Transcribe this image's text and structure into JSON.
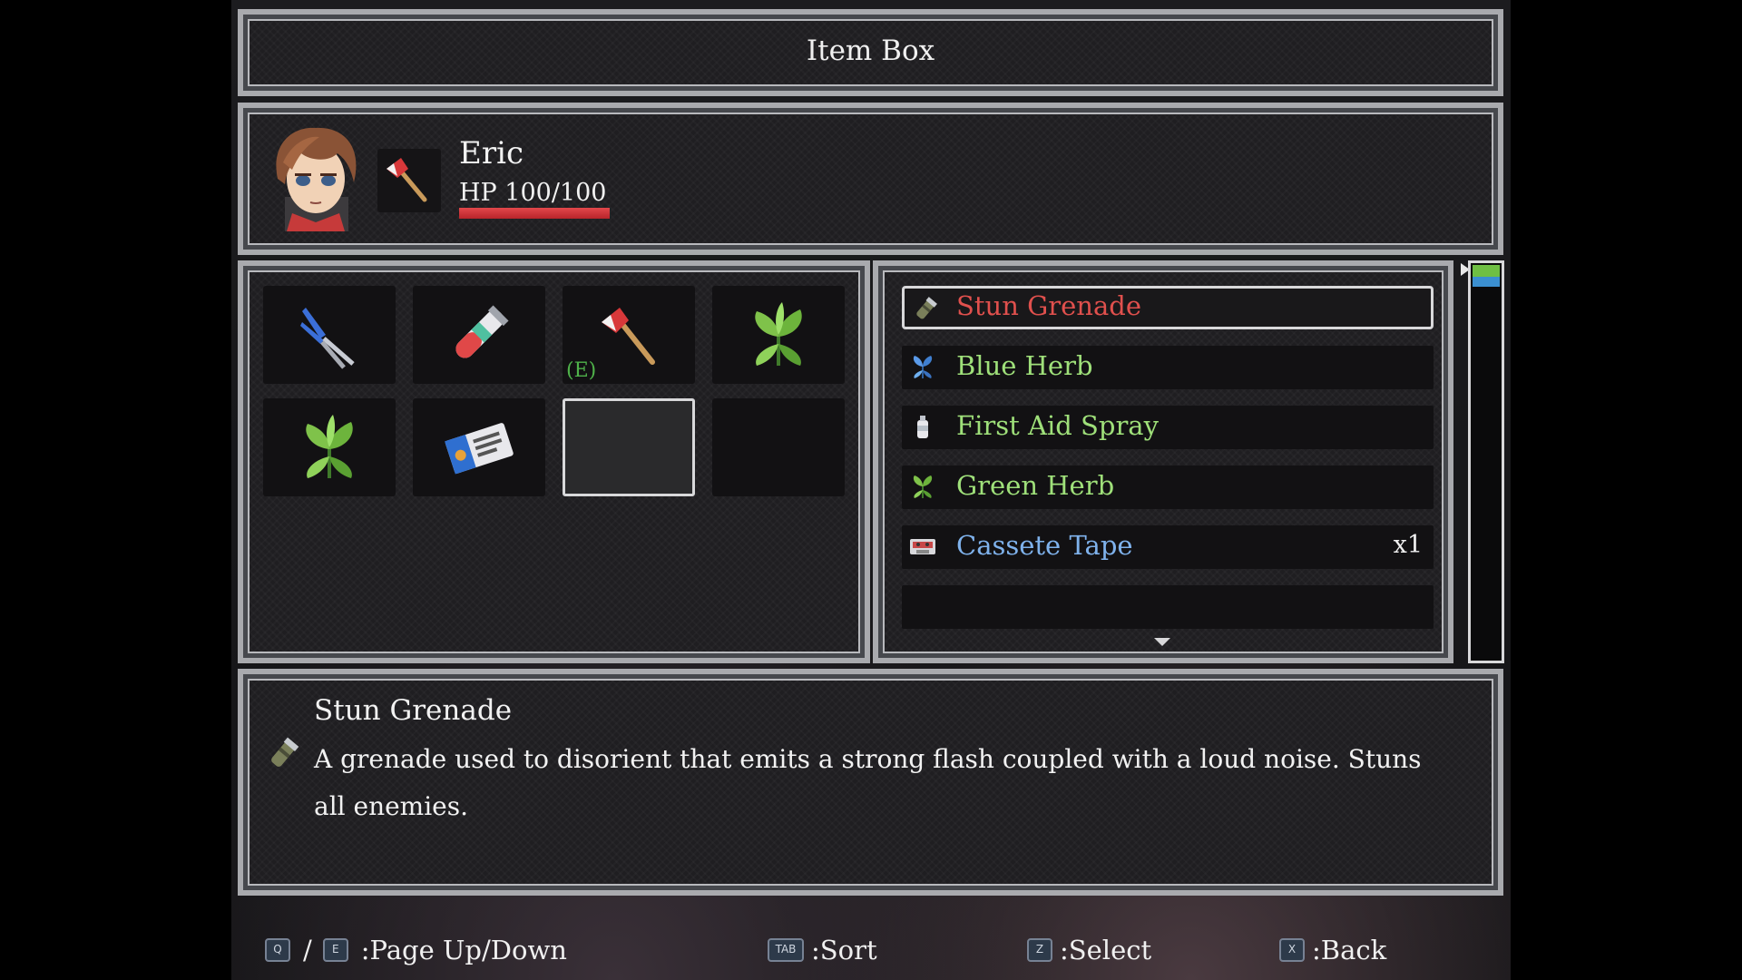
{
  "window": {
    "title": "Item Box"
  },
  "character": {
    "name": "Eric",
    "hp_text": "HP 100/100",
    "hp_fraction": 1.0,
    "equipped_weapon_icon": "axe-icon"
  },
  "grid": {
    "slots": [
      {
        "icon": "bolt-cutter-icon",
        "equipped_label": ""
      },
      {
        "icon": "test-tube-icon",
        "equipped_label": ""
      },
      {
        "icon": "axe-icon",
        "equipped_label": "(E)"
      },
      {
        "icon": "green-herb-icon",
        "equipped_label": ""
      },
      {
        "icon": "green-herb-icon",
        "equipped_label": ""
      },
      {
        "icon": "keycard-icon",
        "equipped_label": ""
      },
      {
        "icon": "empty",
        "equipped_label": "",
        "selected": true
      },
      {
        "icon": "empty",
        "equipped_label": ""
      }
    ]
  },
  "list": {
    "items": [
      {
        "name": "Stun Grenade",
        "qty": "",
        "icon": "grenade-icon",
        "color": "#e0504d"
      },
      {
        "name": "Blue Herb",
        "qty": "",
        "icon": "blue-herb-icon",
        "color": "#9fe07a"
      },
      {
        "name": "First Aid Spray",
        "qty": "",
        "icon": "spray-icon",
        "color": "#9fe07a"
      },
      {
        "name": "Green Herb",
        "qty": "",
        "icon": "green-herb-icon",
        "color": "#9fe07a"
      },
      {
        "name": "Cassete Tape",
        "qty": "x1",
        "icon": "cassette-icon",
        "color": "#7fb2ec"
      }
    ],
    "selected_index": 0
  },
  "description": {
    "title": "Stun Grenade",
    "text": "A grenade used to disorient that emits a strong flash coupled with a loud noise. Stuns all enemies.",
    "icon": "grenade-icon"
  },
  "footer": {
    "page_keys": [
      "Q",
      "E"
    ],
    "page_sep": "/",
    "page_label": ":Page Up/Down",
    "sort_key": "TAB",
    "sort_label": ":Sort",
    "select_key": "Z",
    "select_label": ":Select",
    "back_key": "X",
    "back_label": ":Back"
  }
}
